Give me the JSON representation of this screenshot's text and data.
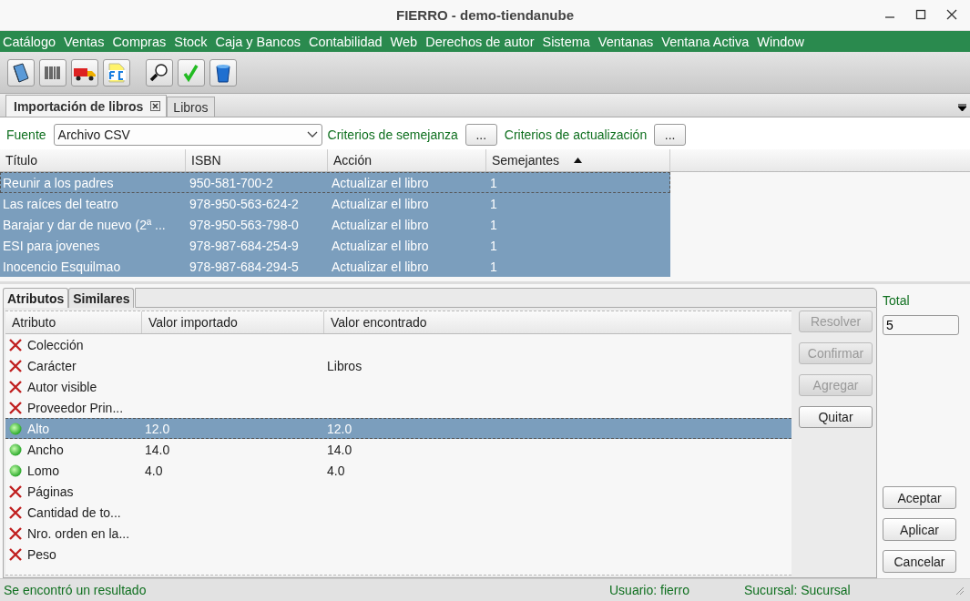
{
  "window": {
    "title": "FIERRO - demo-tiendanube"
  },
  "menu": [
    "Catálogo",
    "Ventas",
    "Compras",
    "Stock",
    "Caja y Bancos",
    "Contabilidad",
    "Web",
    "Derechos de autor",
    "Sistema",
    "Ventanas",
    "Ventana Activa",
    "Window"
  ],
  "doc_tabs": [
    {
      "label": "Importación de libros",
      "selected": true,
      "closable": true
    },
    {
      "label": "Libros",
      "selected": false,
      "closable": false
    }
  ],
  "source": {
    "label": "Fuente",
    "value": "Archivo CSV"
  },
  "criteria": [
    {
      "label": "Criterios de semejanza",
      "button": "..."
    },
    {
      "label": "Criterios de actualización",
      "button": "..."
    }
  ],
  "books_table": {
    "columns": [
      {
        "label": "Título",
        "sorted": false
      },
      {
        "label": "ISBN",
        "sorted": false
      },
      {
        "label": "Acción",
        "sorted": false
      },
      {
        "label": "Semejantes",
        "sorted": true
      }
    ],
    "rows": [
      {
        "cells": [
          "Reunir a los padres",
          "950-581-700-2",
          "Actualizar el libro",
          "1"
        ],
        "selected": true
      },
      {
        "cells": [
          "Las raíces del teatro",
          "978-950-563-624-2",
          "Actualizar el libro",
          "1"
        ],
        "selected": true
      },
      {
        "cells": [
          "Barajar y dar de nuevo (2ª ...",
          "978-950-563-798-0",
          "Actualizar el libro",
          "1"
        ],
        "selected": true
      },
      {
        "cells": [
          "ESI para jovenes",
          "978-987-684-254-9",
          "Actualizar el libro",
          "1"
        ],
        "selected": true
      },
      {
        "cells": [
          "Inocencio Esquilmao",
          "978-987-684-294-5",
          "Actualizar el libro",
          "1"
        ],
        "selected": true
      }
    ]
  },
  "detail_tabs": [
    {
      "label": "Atributos",
      "selected": true
    },
    {
      "label": "Similares",
      "selected": false
    }
  ],
  "attributes_table": {
    "columns": [
      "Atributo",
      "Valor importado",
      "Valor encontrado"
    ],
    "rows": [
      {
        "kind": "mismatch",
        "name": "Colección",
        "imported": "",
        "found": "",
        "selected": false
      },
      {
        "kind": "mismatch",
        "name": "Carácter",
        "imported": "",
        "found": "Libros",
        "selected": false
      },
      {
        "kind": "mismatch",
        "name": "Autor visible",
        "imported": "",
        "found": "",
        "selected": false
      },
      {
        "kind": "mismatch",
        "name": "Proveedor Prin...",
        "imported": "",
        "found": "",
        "selected": false
      },
      {
        "kind": "match",
        "name": "Alto",
        "imported": "12.0",
        "found": "12.0",
        "selected": true
      },
      {
        "kind": "match",
        "name": "Ancho",
        "imported": "14.0",
        "found": "14.0",
        "selected": false
      },
      {
        "kind": "match",
        "name": "Lomo",
        "imported": "4.0",
        "found": "4.0",
        "selected": false
      },
      {
        "kind": "mismatch",
        "name": "Páginas",
        "imported": "",
        "found": "",
        "selected": false
      },
      {
        "kind": "mismatch",
        "name": "Cantidad de to...",
        "imported": "",
        "found": "",
        "selected": false
      },
      {
        "kind": "mismatch",
        "name": "Nro. orden en la...",
        "imported": "",
        "found": "",
        "selected": false
      },
      {
        "kind": "mismatch",
        "name": "Peso",
        "imported": "",
        "found": "",
        "selected": false
      }
    ]
  },
  "attribute_buttons": [
    {
      "label": "Resolver",
      "disabled": true
    },
    {
      "label": "Confirmar",
      "disabled": true
    },
    {
      "label": "Agregar",
      "disabled": true
    },
    {
      "label": "Quitar",
      "disabled": false
    }
  ],
  "total": {
    "label": "Total",
    "value": "5"
  },
  "dialog_buttons": [
    "Aceptar",
    "Aplicar",
    "Cancelar"
  ],
  "status_bar": {
    "message": "Se encontró un resultado",
    "user": "Usuario: fierro",
    "branch": "Sucursal: Sucursal"
  }
}
